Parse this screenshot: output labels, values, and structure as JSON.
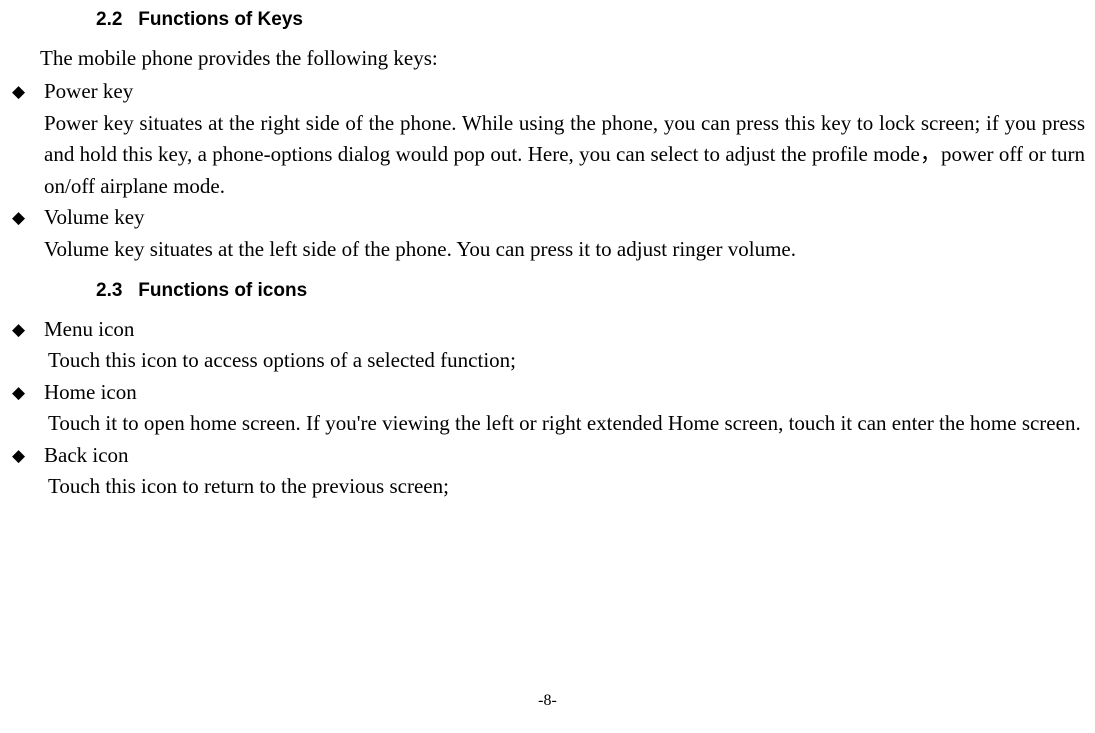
{
  "headings": {
    "h22_num": "2.2",
    "h22_title": "Functions of Keys",
    "h23_num": "2.3",
    "h23_title": "Functions of icons"
  },
  "intro22": "The mobile phone provides the following keys:",
  "keys": {
    "power": {
      "label": "Power key",
      "body": "Power key situates at the right side of the phone. While using the phone, you can press this key to lock screen; if you press and hold this key, a phone-options dialog would pop out. Here, you can select to adjust the profile mode，power off or turn on/off airplane mode."
    },
    "volume": {
      "label": "Volume key",
      "body": "Volume key situates at the left side of the phone. You can press it to adjust ringer volume."
    }
  },
  "icons": {
    "menu": {
      "label": "Menu icon",
      "body": "Touch this icon to access options of a selected function;"
    },
    "home": {
      "label": "Home icon",
      "body": "Touch it to open home screen. If you're viewing the left or right extended Home screen, touch it can enter the home screen."
    },
    "back": {
      "label": "Back icon",
      "body": "Touch this icon to return to the previous screen;"
    }
  },
  "page_number": "-8-"
}
